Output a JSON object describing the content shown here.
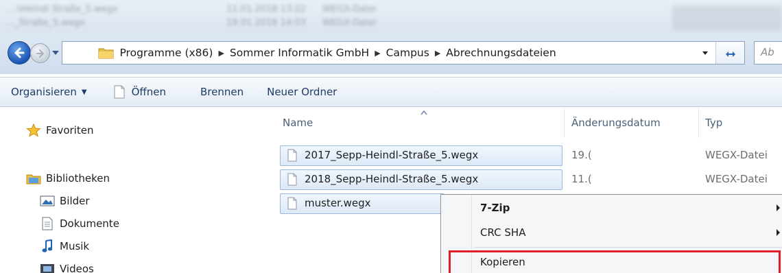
{
  "background_rows": [
    {
      "a": "…:\\Heindl Straße_5.wegx",
      "b": "11.01.2018 13:22",
      "c": "WEGX-Datei"
    },
    {
      "a": "…_Straße_5.wegx",
      "b": "19.01.2018 14:03",
      "c": "WEGX-Datei"
    }
  ],
  "address": {
    "overflow": "«",
    "crumbs": [
      "Programme (x86)",
      "Sommer Informatik GmbH",
      "Campus",
      "Abrechnungsdateien"
    ],
    "search_placeholder": "Ab"
  },
  "toolbar": {
    "organise": "Organisieren",
    "open": "Öffnen",
    "burn": "Brennen",
    "new_folder": "Neuer Ordner"
  },
  "navigation": {
    "favorites": "Favoriten",
    "libraries": "Bibliotheken",
    "library_items": [
      "Bilder",
      "Dokumente",
      "Musik",
      "Videos"
    ]
  },
  "columns": {
    "name": "Name",
    "date": "Änderungsdatum",
    "type": "Typ"
  },
  "files": [
    {
      "name": "2017_Sepp-Heindl-Straße_5.wegx",
      "date": "19.(",
      "type": "WEGX-Datei",
      "selected": true
    },
    {
      "name": "2018_Sepp-Heindl-Straße_5.wegx",
      "date": "11.(",
      "type": "WEGX-Datei",
      "selected": true
    },
    {
      "name": "muster.wegx",
      "date": "",
      "type": "",
      "selected": true
    }
  ],
  "context_menu": {
    "items": [
      {
        "label": "7-Zip",
        "bold": true,
        "submenu": true
      },
      {
        "label": "CRC SHA",
        "bold": false,
        "submenu": true
      },
      {
        "label": "Kopieren",
        "bold": false,
        "submenu": false
      }
    ],
    "highlight_color": "#e01e2b"
  },
  "colors": {
    "accent": "#1c56b3",
    "selection_border": "#9ab8de",
    "toolbar_text": "#1e3c66"
  }
}
